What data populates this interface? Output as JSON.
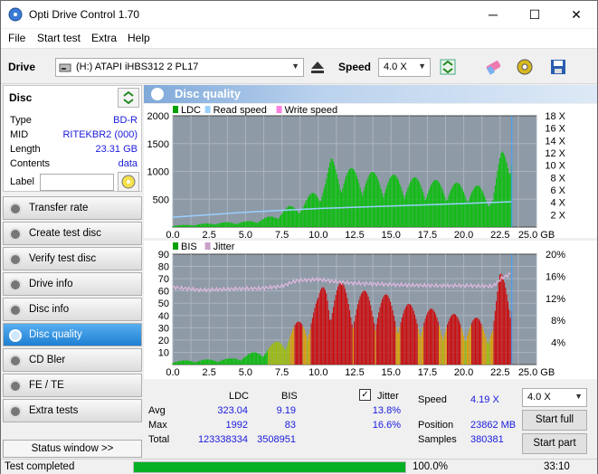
{
  "window": {
    "title": "Opti Drive Control 1.70",
    "min": "─",
    "max": "☐",
    "close": "✕"
  },
  "menu": [
    "File",
    "Start test",
    "Extra",
    "Help"
  ],
  "toolbar": {
    "drive_label": "Drive",
    "drive_value": "(H:)   ATAPI iHBS312   2 PL17",
    "speed_label": "Speed",
    "speed_value": "4.0 X"
  },
  "disc": {
    "header": "Disc",
    "rows": [
      {
        "k": "Type",
        "v": "BD-R"
      },
      {
        "k": "MID",
        "v": "RITEKBR2 (000)"
      },
      {
        "k": "Length",
        "v": "23.31 GB"
      },
      {
        "k": "Contents",
        "v": "data"
      }
    ],
    "label_key": "Label",
    "label_value": ""
  },
  "nav": [
    {
      "label": "Transfer rate",
      "active": false
    },
    {
      "label": "Create test disc",
      "active": false
    },
    {
      "label": "Verify test disc",
      "active": false
    },
    {
      "label": "Drive info",
      "active": false
    },
    {
      "label": "Disc info",
      "active": false
    },
    {
      "label": "Disc quality",
      "active": true
    },
    {
      "label": "CD Bler",
      "active": false
    },
    {
      "label": "FE / TE",
      "active": false
    },
    {
      "label": "Extra tests",
      "active": false
    }
  ],
  "status_window": "Status window >>",
  "panel_title": "Disc quality",
  "chart_data": [
    {
      "type": "area",
      "legend": [
        "LDC",
        "Read speed",
        "Write speed"
      ],
      "legend_colors": [
        "#00a000",
        "#9ad0ff",
        "#ff80e0"
      ],
      "x_ticks": [
        "0.0",
        "2.5",
        "5.0",
        "7.5",
        "10.0",
        "12.5",
        "15.0",
        "17.5",
        "20.0",
        "22.5",
        "25.0 GB"
      ],
      "y_left_ticks": [
        "500",
        "1000",
        "1500",
        "2000"
      ],
      "y_right_ticks": [
        "2 X",
        "4 X",
        "6 X",
        "8 X",
        "10 X",
        "12 X",
        "14 X",
        "16 X",
        "18 X"
      ],
      "xlim": [
        0,
        25
      ],
      "ylim": [
        0,
        2000
      ],
      "y2lim": [
        0,
        18
      ],
      "ldc": [
        [
          0,
          30
        ],
        [
          1,
          40
        ],
        [
          2,
          60
        ],
        [
          3,
          80
        ],
        [
          4,
          90
        ],
        [
          5,
          100
        ],
        [
          6,
          140
        ],
        [
          7,
          220
        ],
        [
          8,
          380
        ],
        [
          9,
          450
        ],
        [
          9.8,
          700
        ],
        [
          10.5,
          900
        ],
        [
          10.9,
          1250
        ],
        [
          11.5,
          1100
        ],
        [
          12.5,
          1050
        ],
        [
          13.5,
          1000
        ],
        [
          15,
          950
        ],
        [
          16.5,
          900
        ],
        [
          18,
          850
        ],
        [
          19.5,
          800
        ],
        [
          21,
          750
        ],
        [
          22,
          600
        ],
        [
          22.6,
          1400
        ],
        [
          23.3,
          1700
        ],
        [
          23.4,
          0
        ]
      ],
      "read_speed": [
        [
          0,
          1.6
        ],
        [
          5,
          2.4
        ],
        [
          10,
          3.0
        ],
        [
          15,
          3.4
        ],
        [
          20,
          3.8
        ],
        [
          23.3,
          4.1
        ]
      ]
    },
    {
      "type": "area",
      "legend": [
        "BIS",
        "Jitter"
      ],
      "legend_colors": [
        "#00a000",
        "#c8a0c8"
      ],
      "x_ticks": [
        "0.0",
        "2.5",
        "5.0",
        "7.5",
        "10.0",
        "12.5",
        "15.0",
        "17.5",
        "20.0",
        "22.5",
        "25.0 GB"
      ],
      "y_left_ticks": [
        "10",
        "20",
        "30",
        "40",
        "50",
        "60",
        "70",
        "80",
        "90"
      ],
      "y_right_ticks": [
        "4%",
        "8%",
        "12%",
        "16%",
        "20%"
      ],
      "xlim": [
        0,
        25
      ],
      "ylim": [
        0,
        90
      ],
      "y2lim": [
        0,
        20
      ],
      "bis": [
        [
          0,
          3
        ],
        [
          2,
          4
        ],
        [
          4,
          5
        ],
        [
          5,
          8
        ],
        [
          6,
          12
        ],
        [
          7,
          18
        ],
        [
          8,
          28
        ],
        [
          9,
          40
        ],
        [
          10,
          55
        ],
        [
          10.6,
          80
        ],
        [
          11,
          70
        ],
        [
          12,
          65
        ],
        [
          13,
          60
        ],
        [
          14,
          62
        ],
        [
          15,
          55
        ],
        [
          16,
          50
        ],
        [
          17,
          48
        ],
        [
          18,
          45
        ],
        [
          19,
          42
        ],
        [
          20,
          40
        ],
        [
          21,
          38
        ],
        [
          22,
          35
        ],
        [
          22.5,
          75
        ],
        [
          23.3,
          83
        ],
        [
          23.4,
          0
        ]
      ],
      "jitter": [
        [
          0,
          14.0
        ],
        [
          2,
          13.5
        ],
        [
          4,
          13.7
        ],
        [
          6,
          13.8
        ],
        [
          7.5,
          14.2
        ],
        [
          8.5,
          15.2
        ],
        [
          10,
          15.4
        ],
        [
          12,
          14.8
        ],
        [
          14,
          14.6
        ],
        [
          16,
          14.4
        ],
        [
          18,
          14.3
        ],
        [
          20,
          14.3
        ],
        [
          22,
          14.2
        ],
        [
          22.6,
          15.6
        ],
        [
          23.3,
          16.6
        ]
      ]
    }
  ],
  "stats": {
    "col_ldc": "LDC",
    "col_bis": "BIS",
    "jitter_label": "Jitter",
    "jitter_checked": "✓",
    "rows": [
      {
        "k": "Avg",
        "ldc": "323.04",
        "bis": "9.19",
        "jit": "13.8%"
      },
      {
        "k": "Max",
        "ldc": "1992",
        "bis": "83",
        "jit": "16.6%"
      },
      {
        "k": "Total",
        "ldc": "123338334",
        "bis": "3508951",
        "jit": ""
      }
    ],
    "speed_label": "Speed",
    "speed_value": "4.19 X",
    "position_label": "Position",
    "position_value": "23862 MB",
    "samples_label": "Samples",
    "samples_value": "380381",
    "speed_select": "4.0 X",
    "start_full": "Start full",
    "start_part": "Start part"
  },
  "statusbar": {
    "text": "Test completed",
    "progress": 1.0,
    "percent": "100.0%",
    "time": "33:10"
  }
}
